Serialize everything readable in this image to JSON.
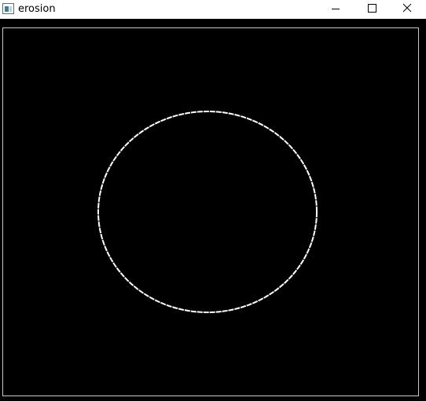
{
  "window": {
    "title": "erosion",
    "controls": {
      "minimize_icon": "minimize-icon",
      "maximize_icon": "maximize-icon",
      "close_icon": "close-icon"
    }
  },
  "image": {
    "background_color": "#000000",
    "stroke_color": "#ffffff",
    "content": "ellipse-outline"
  }
}
